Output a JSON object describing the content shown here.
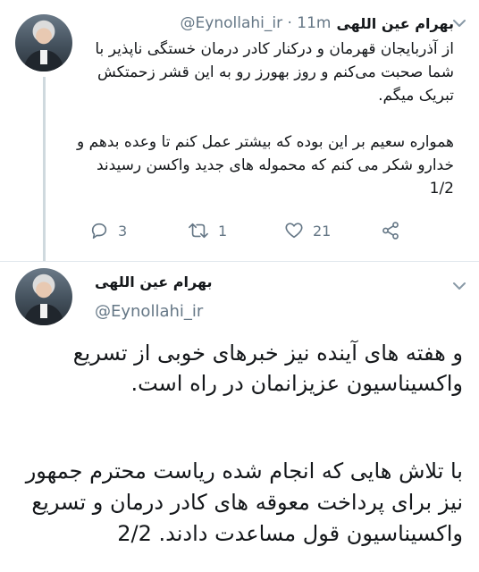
{
  "tweet1": {
    "author_name": "بهرام عین اللهی",
    "handle_time": "@Eynollahi_ir · 11m",
    "paragraph1": "از آذربایجان قهرمان و درکنار کادر درمان خستگی ناپذیر با شما صحبت می‌کنم و روز بهورز رو به این قشر زحمتکش تبریک میگم.",
    "paragraph2": "همواره سعیم بر این بوده که بیشتر عمل کنم تا وعده بدهم و خدارو شکر می کنم که محموله های جدید واکسن رسیدند 1/2",
    "reply_count": "3",
    "retweet_count": "1",
    "like_count": "21"
  },
  "tweet2": {
    "author_name": "بهرام عین اللهی",
    "handle": "@Eynollahi_ir",
    "paragraph1": "و هفته های آینده نیز خبرهای خوبی از تسریع واکسیناسیون عزیزانمان در راه است.",
    "paragraph2": "با تلاش هایی که انجام شده ریاست محترم جمهور نیز برای پرداخت معوقه های کادر درمان و تسریع واکسیناسیون قول مساعدت دادند. 2/2"
  },
  "icons": {
    "reply": "reply-icon",
    "retweet": "retweet-icon",
    "like": "heart-icon",
    "share": "share-icon",
    "menu": "chevron-down-icon"
  },
  "colors": {
    "secondary_text": "#657786",
    "divider": "#e1e8ed",
    "thread_line": "#cfd9de"
  }
}
